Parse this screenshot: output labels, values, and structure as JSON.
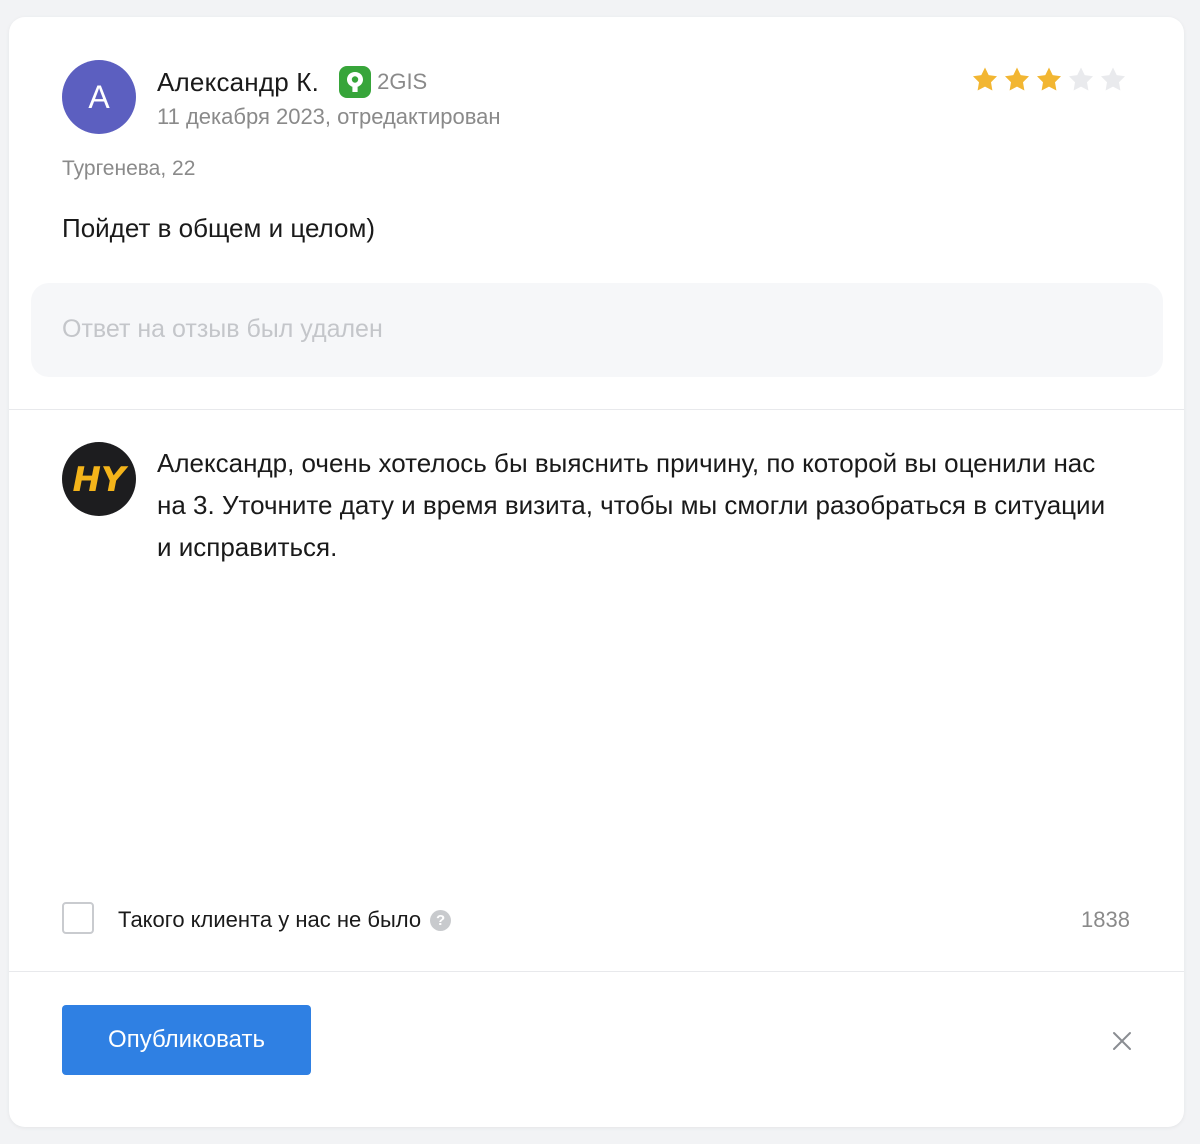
{
  "review": {
    "avatar_letter": "A",
    "author": "Александр К.",
    "source": "2GIS",
    "date": "11 декабря 2023, отредактирован",
    "rating": 3,
    "max_rating": 5,
    "address": "Тургенева, 22",
    "text": "Пойдет в общем и целом)"
  },
  "deleted_reply": {
    "text": "Ответ на отзыв был удален"
  },
  "reply_editor": {
    "avatar_text": "HY",
    "text": "Александр, очень хотелось бы выяснить причину, по которой вы оценили нас на 3. Уточните дату и время визита, чтобы мы смогли разобраться в ситуации и исправиться."
  },
  "options": {
    "no_client_label": "Такого клиента у нас не было",
    "no_client_checked": false,
    "help_icon": "?",
    "char_count": "1838"
  },
  "actions": {
    "publish_label": "Опубликовать"
  },
  "colors": {
    "accent": "#2f80e3",
    "star_filled": "#f2b632",
    "star_empty": "#e9eaed",
    "avatar": "#5c5fc0",
    "source_green": "#37a53a",
    "reply_avatar_text": "#f4b41a"
  },
  "icons": {
    "source": "2gis-logo-icon",
    "star": "star-icon",
    "help": "question-icon",
    "close": "close-icon"
  }
}
